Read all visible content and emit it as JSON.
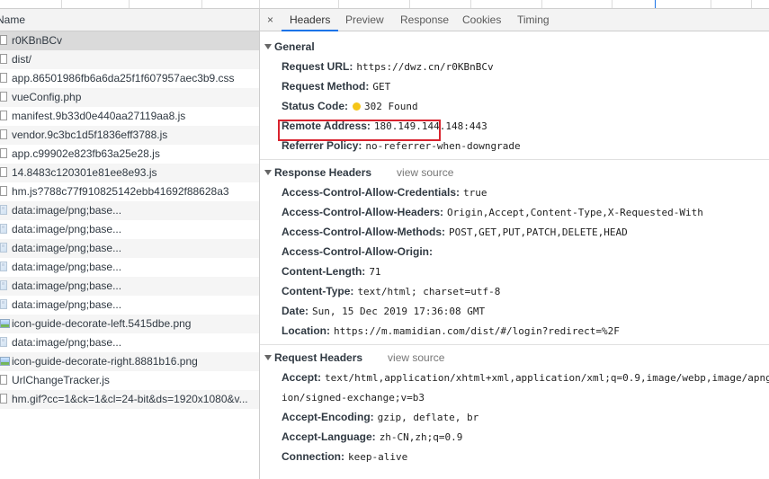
{
  "requests": {
    "header": "Name",
    "rows": [
      {
        "name": "r0KBnBCv",
        "icon": "doc"
      },
      {
        "name": "dist/",
        "icon": "doc"
      },
      {
        "name": "app.86501986fb6a6da25f1f607957aec3b9.css",
        "icon": "doc"
      },
      {
        "name": "vueConfig.php",
        "icon": "doc"
      },
      {
        "name": "manifest.9b33d0e440aa27119aa8.js",
        "icon": "doc"
      },
      {
        "name": "vendor.9c3bc1d5f1836eff3788.js",
        "icon": "doc"
      },
      {
        "name": "app.c99902e823fb63a25e28.js",
        "icon": "doc"
      },
      {
        "name": "14.8483c120301e81ee8e93.js",
        "icon": "doc"
      },
      {
        "name": "hm.js?788c77f910825142ebb41692f88628a3",
        "icon": "doc"
      },
      {
        "name": "data:image/png;base...",
        "icon": "img"
      },
      {
        "name": "data:image/png;base...",
        "icon": "img"
      },
      {
        "name": "data:image/png;base...",
        "icon": "img"
      },
      {
        "name": "data:image/png;base...",
        "icon": "img"
      },
      {
        "name": "data:image/png;base...",
        "icon": "img"
      },
      {
        "name": "data:image/png;base...",
        "icon": "img"
      },
      {
        "name": "icon-guide-decorate-left.5415dbe.png",
        "icon": "imgpic"
      },
      {
        "name": "data:image/png;base...",
        "icon": "img"
      },
      {
        "name": "icon-guide-decorate-right.8881b16.png",
        "icon": "imgpic"
      },
      {
        "name": "UrlChangeTracker.js",
        "icon": "doc"
      },
      {
        "name": "hm.gif?cc=1&ck=1&cl=24-bit&ds=1920x1080&v...",
        "icon": "doc"
      }
    ]
  },
  "tabs": {
    "close": "×",
    "items": [
      "Headers",
      "Preview",
      "Response",
      "Cookies",
      "Timing"
    ]
  },
  "general": {
    "title": "General",
    "request_url_k": "Request URL:",
    "request_url_v": "https://dwz.cn/r0KBnBCv",
    "request_method_k": "Request Method:",
    "request_method_v": "GET",
    "status_code_k": "Status Code:",
    "status_code_v": "302 Found",
    "remote_address_k": "Remote Address:",
    "remote_address_v": "180.149.144.148:443",
    "referrer_policy_k": "Referrer Policy:",
    "referrer_policy_v": "no-referrer-when-downgrade"
  },
  "response_headers": {
    "title": "Response Headers",
    "view_source": "view source",
    "items": [
      {
        "k": "Access-Control-Allow-Credentials:",
        "v": "true"
      },
      {
        "k": "Access-Control-Allow-Headers:",
        "v": "Origin,Accept,Content-Type,X-Requested-With"
      },
      {
        "k": "Access-Control-Allow-Methods:",
        "v": "POST,GET,PUT,PATCH,DELETE,HEAD"
      },
      {
        "k": "Access-Control-Allow-Origin:",
        "v": ""
      },
      {
        "k": "Content-Length:",
        "v": "71"
      },
      {
        "k": "Content-Type:",
        "v": "text/html; charset=utf-8"
      },
      {
        "k": "Date:",
        "v": "Sun, 15 Dec 2019 17:36:08 GMT"
      },
      {
        "k": "Location:",
        "v": "https://m.mamidian.com/dist/#/login?redirect=%2F"
      }
    ]
  },
  "request_headers": {
    "title": "Request Headers",
    "view_source": "view source",
    "accept_k": "Accept:",
    "accept_v": "text/html,application/xhtml+xml,application/xml;q=0.9,image/webp,image/apng",
    "accept_v2": "ion/signed-exchange;v=b3",
    "accept_encoding_k": "Accept-Encoding:",
    "accept_encoding_v": "gzip, deflate, br",
    "accept_language_k": "Accept-Language:",
    "accept_language_v": "zh-CN,zh;q=0.9",
    "connection_k": "Connection:",
    "connection_v": "keep-alive"
  },
  "colors": {
    "highlight_box": "#d9232e",
    "status_dot": "#f5c518",
    "active_tab": "#1a73e8"
  }
}
